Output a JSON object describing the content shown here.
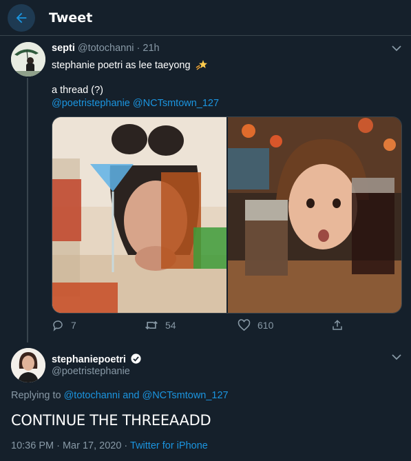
{
  "header": {
    "title": "Tweet"
  },
  "tweet1": {
    "display_name": "septi",
    "handle": "@totochanni",
    "separator": "·",
    "time": "21h",
    "line1": "stephanie poetri as lee taeyong",
    "line2": "a thread (?)",
    "mention1": "@poetristephanie",
    "mention2": "@NCTsmtown_127",
    "stats": {
      "replies": "7",
      "retweets": "54",
      "likes": "610"
    }
  },
  "tweet2": {
    "display_name": "stephaniepoetri",
    "handle": "@poetristephanie",
    "replying_prefix": "Replying to",
    "replying_user1": "@totochanni",
    "replying_and": "and",
    "replying_user2": "@NCTsmtown_127",
    "text": "CONTINUE THE THREEAADD",
    "timestamp": "10:36 PM · Mar 17, 2020 ·",
    "source": "Twitter for iPhone"
  },
  "colors": {
    "background": "#15202b",
    "accent": "#1b95e0",
    "muted": "#8899a6",
    "border": "#38444d"
  },
  "icons": [
    "back-arrow-icon",
    "chevron-down-icon",
    "verified-badge-icon",
    "reply-icon",
    "retweet-icon",
    "like-icon",
    "share-icon",
    "star-emoji-icon"
  ]
}
